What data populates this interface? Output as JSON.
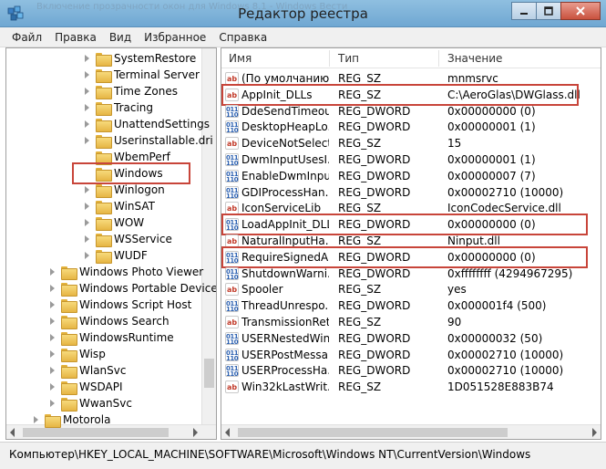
{
  "window": {
    "title": "Редактор реестра",
    "faded_text": "Включение прозрачности окон для Windows 8.1 - Windows Вести"
  },
  "menu": [
    "Файл",
    "Правка",
    "Вид",
    "Избранное",
    "Справка"
  ],
  "tree": {
    "items": [
      {
        "label": "SystemRestore",
        "level": 2,
        "has_children": true
      },
      {
        "label": "Terminal Server",
        "level": 2,
        "has_children": true
      },
      {
        "label": "Time Zones",
        "level": 2,
        "has_children": true
      },
      {
        "label": "Tracing",
        "level": 2,
        "has_children": true
      },
      {
        "label": "UnattendSettings",
        "level": 2,
        "has_children": true
      },
      {
        "label": "Userinstallable.dri",
        "level": 2,
        "has_children": true
      },
      {
        "label": "WbemPerf",
        "level": 2,
        "has_children": false
      },
      {
        "label": "Windows",
        "level": 2,
        "has_children": false,
        "highlighted": true
      },
      {
        "label": "Winlogon",
        "level": 2,
        "has_children": true
      },
      {
        "label": "WinSAT",
        "level": 2,
        "has_children": true
      },
      {
        "label": "WOW",
        "level": 2,
        "has_children": true
      },
      {
        "label": "WSService",
        "level": 2,
        "has_children": true
      },
      {
        "label": "WUDF",
        "level": 2,
        "has_children": true
      },
      {
        "label": "Windows Photo Viewer",
        "level": 1,
        "has_children": true
      },
      {
        "label": "Windows Portable Device",
        "level": 1,
        "has_children": true
      },
      {
        "label": "Windows Script Host",
        "level": 1,
        "has_children": true
      },
      {
        "label": "Windows Search",
        "level": 1,
        "has_children": true
      },
      {
        "label": "WindowsRuntime",
        "level": 1,
        "has_children": true
      },
      {
        "label": "Wisp",
        "level": 1,
        "has_children": true
      },
      {
        "label": "WlanSvc",
        "level": 1,
        "has_children": true
      },
      {
        "label": "WSDAPI",
        "level": 1,
        "has_children": true
      },
      {
        "label": "WwanSvc",
        "level": 1,
        "has_children": true
      },
      {
        "label": "Motorola",
        "level": 0,
        "has_children": true
      }
    ]
  },
  "list": {
    "headers": {
      "name": "Имя",
      "type": "Тип",
      "value": "Значение"
    },
    "rows": [
      {
        "name": "(По умолчанию)",
        "type": "REG_SZ",
        "value": "mnmsrvc",
        "icon": "ab"
      },
      {
        "name": "AppInit_DLLs",
        "type": "REG_SZ",
        "value": "C:\\AeroGlas\\DWGlass.dll",
        "icon": "ab",
        "highlighted": true
      },
      {
        "name": "DdeSendTimeout",
        "type": "REG_DWORD",
        "value": "0x00000000 (0)",
        "icon": "bin"
      },
      {
        "name": "DesktopHeapLo...",
        "type": "REG_DWORD",
        "value": "0x00000001 (1)",
        "icon": "bin"
      },
      {
        "name": "DeviceNotSelect...",
        "type": "REG_SZ",
        "value": "15",
        "icon": "ab"
      },
      {
        "name": "DwmInputUsesI...",
        "type": "REG_DWORD",
        "value": "0x00000001 (1)",
        "icon": "bin"
      },
      {
        "name": "EnableDwmInpu...",
        "type": "REG_DWORD",
        "value": "0x00000007 (7)",
        "icon": "bin"
      },
      {
        "name": "GDIProcessHan...",
        "type": "REG_DWORD",
        "value": "0x00002710 (10000)",
        "icon": "bin"
      },
      {
        "name": "IconServiceLib",
        "type": "REG_SZ",
        "value": "IconCodecService.dll",
        "icon": "ab"
      },
      {
        "name": "LoadAppInit_DLLs",
        "type": "REG_DWORD",
        "value": "0x00000000 (0)",
        "icon": "bin",
        "highlighted": true
      },
      {
        "name": "NaturalInputHa...",
        "type": "REG_SZ",
        "value": "Ninput.dll",
        "icon": "ab"
      },
      {
        "name": "RequireSignedA...",
        "type": "REG_DWORD",
        "value": "0x00000000 (0)",
        "icon": "bin",
        "highlighted": true
      },
      {
        "name": "ShutdownWarni...",
        "type": "REG_DWORD",
        "value": "0xffffffff (4294967295)",
        "icon": "bin"
      },
      {
        "name": "Spooler",
        "type": "REG_SZ",
        "value": "yes",
        "icon": "ab"
      },
      {
        "name": "ThreadUnrespo...",
        "type": "REG_DWORD",
        "value": "0x000001f4 (500)",
        "icon": "bin"
      },
      {
        "name": "TransmissionRet...",
        "type": "REG_SZ",
        "value": "90",
        "icon": "ab"
      },
      {
        "name": "USERNestedWin...",
        "type": "REG_DWORD",
        "value": "0x00000032 (50)",
        "icon": "bin"
      },
      {
        "name": "USERPostMessa...",
        "type": "REG_DWORD",
        "value": "0x00002710 (10000)",
        "icon": "bin"
      },
      {
        "name": "USERProcessHa...",
        "type": "REG_DWORD",
        "value": "0x00002710 (10000)",
        "icon": "bin"
      },
      {
        "name": "Win32kLastWrit...",
        "type": "REG_SZ",
        "value": "1D051528E883B74",
        "icon": "ab"
      }
    ]
  },
  "icons": {
    "ab": "ab",
    "bin": "011\n110"
  },
  "status": {
    "path": "Компьютер\\HKEY_LOCAL_MACHINE\\SOFTWARE\\Microsoft\\Windows NT\\CurrentVersion\\Windows"
  },
  "colors": {
    "highlight": "#c8453a",
    "sz_icon": "#c23b2a",
    "bin_icon": "#2a5fb0"
  }
}
